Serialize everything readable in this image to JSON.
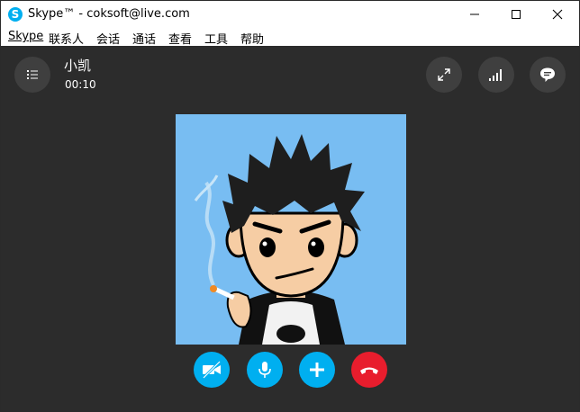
{
  "window": {
    "title": "Skype™ - coksoft@live.com"
  },
  "menu": [
    "Skype",
    "联系人",
    "会话",
    "通话",
    "查看",
    "工具",
    "帮助"
  ],
  "call": {
    "contact_name": "小凯",
    "duration": "00:10"
  },
  "colors": {
    "background": "#2c2c2c",
    "accent": "#00aff0",
    "hangup": "#e81d2d",
    "avatar_bg": "#78bdf2"
  }
}
